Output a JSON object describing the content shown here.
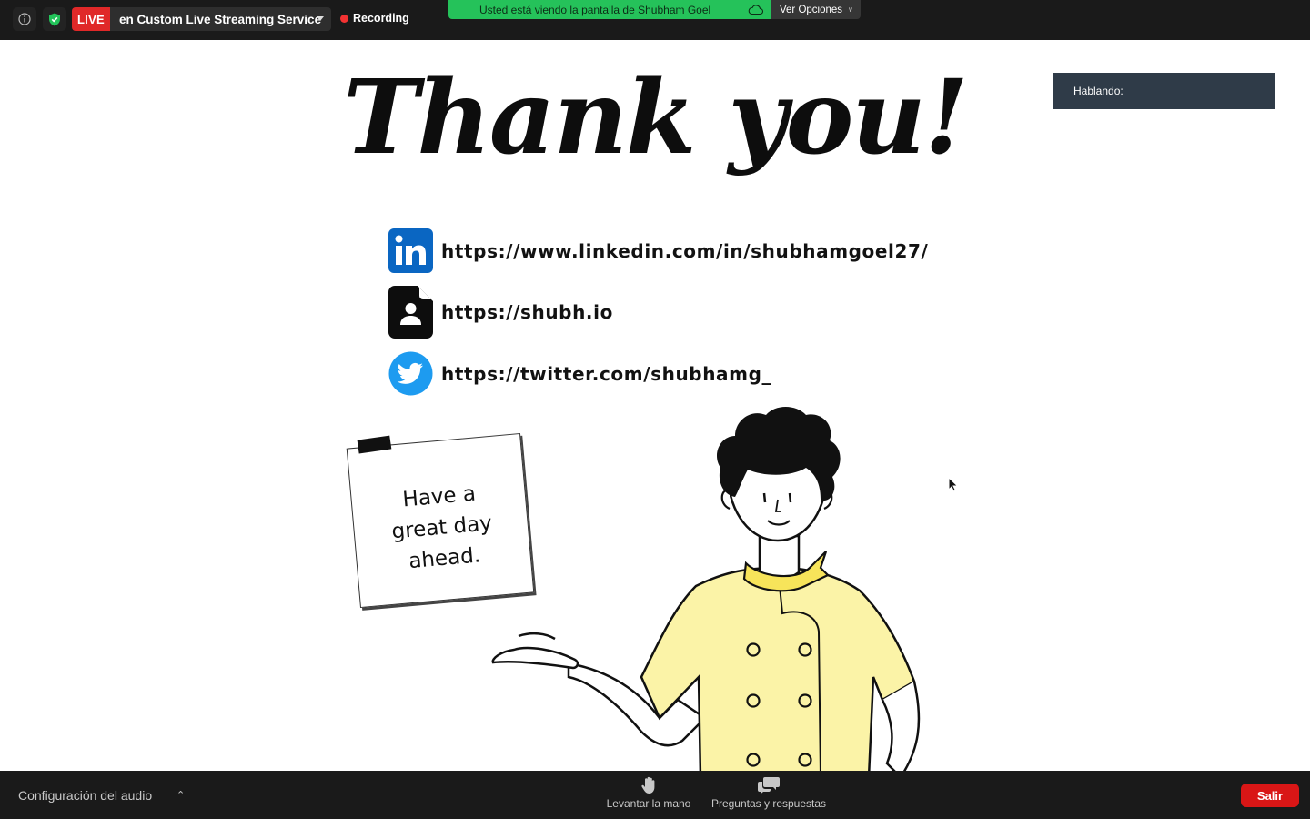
{
  "topbar": {
    "live_label": "LIVE",
    "stream_service": "en Custom Live Streaming Service",
    "recording_label": "Recording",
    "share_banner": "Usted está viendo la pantalla de Shubham Goel",
    "view_options": "Ver Opciones"
  },
  "slide": {
    "title": "Thank you!",
    "links": [
      {
        "icon": "linkedin-icon",
        "url": "https://www.linkedin.com/in/shubhamgoel27/"
      },
      {
        "icon": "resume-icon",
        "url": "https://shubh.io"
      },
      {
        "icon": "twitter-icon",
        "url": "https://twitter.com/shubhamg_"
      }
    ],
    "note_lines": [
      "Have a",
      "great day",
      "ahead."
    ]
  },
  "speaking_label": "Hablando:",
  "bottombar": {
    "audio_settings": "Configuración del audio",
    "raise_hand": "Levantar la mano",
    "qa": "Preguntas y respuestas",
    "leave": "Salir"
  },
  "colors": {
    "live_red": "#e02828",
    "share_green": "#25c25a",
    "leave_red": "#d91616",
    "linkedin_blue": "#0a66c2",
    "twitter_blue": "#1d9bf0",
    "chef_yellow": "#fbf3a7",
    "scarf_yellow": "#f7e45a"
  }
}
